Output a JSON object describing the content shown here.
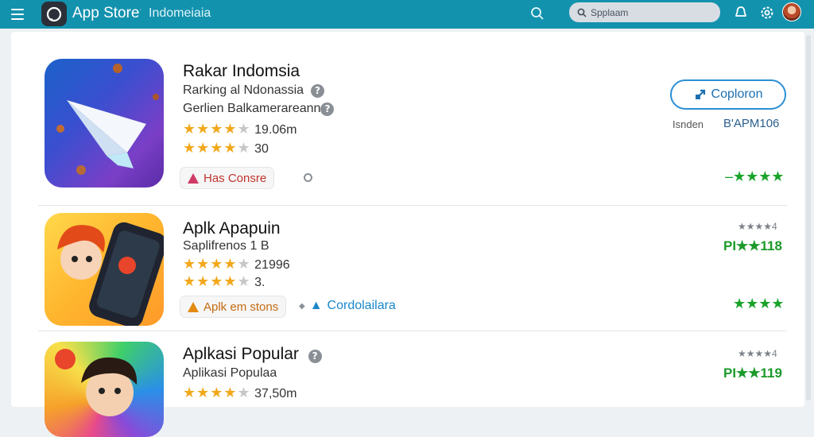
{
  "header": {
    "title": "App Store",
    "title_mark": "·",
    "region": "Indomeiaia",
    "search_placeholder": "Spplaam",
    "icons": [
      "menu-icon",
      "app-store-logo-icon",
      "search-icon",
      "bell-icon",
      "gear-icon",
      "avatar"
    ]
  },
  "apps": [
    {
      "name": "Rakar Indomsia",
      "subtitle": "Rarking al Ndonassia",
      "developer": "Gerlien Balkamerareann",
      "rating1_stars": 4,
      "rating1_value": "19.06m",
      "rating2_stars": 4,
      "rating2_value": "30",
      "badge": "Has Consre",
      "action_label": "Coploron",
      "meta_label": "Isnden",
      "meta_value": "B'APM106",
      "right_stars": "–★★★★",
      "icon": "paper-plane-icon"
    },
    {
      "name": "Aplk Apapuin",
      "subtitle": "Saplifrenos 1 B",
      "rating1_stars": 4,
      "rating1_value": "21996",
      "rating2_stars": 4,
      "rating2_value": "3.",
      "badge": "Aplk em stons",
      "link": "Cordolailara",
      "small_stars": "★★★★4",
      "price": "PI★★118",
      "right_stars": "★★★★",
      "icon": "cartoon-phone-icon"
    },
    {
      "name": "Aplkasi Popular",
      "subtitle": "Aplikasi Populaa",
      "rating1_stars": 4,
      "rating1_value": "37,50m",
      "small_stars": "★★★★4",
      "price": "PI★★119",
      "icon": "cartoon-girl-icon"
    }
  ],
  "colors": {
    "topbar": "#1392ae",
    "star": "#f2a81c",
    "green": "#1aa32a",
    "accent": "#2b8fd6"
  }
}
